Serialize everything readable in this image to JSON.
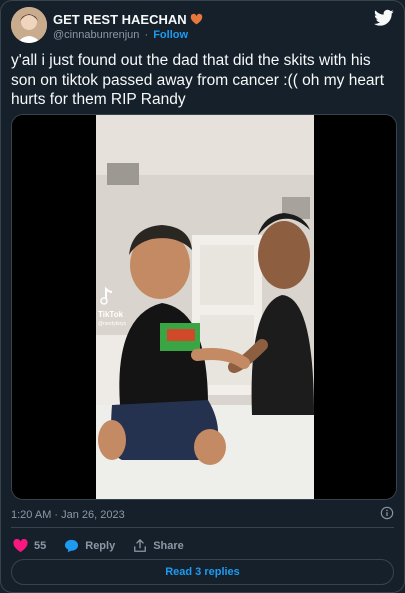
{
  "user": {
    "display_name": "GET REST HAECHAN",
    "handle": "@cinnabunrenjun",
    "separator": "·",
    "follow_label": "Follow",
    "avatar_icon": "avatar-photo",
    "name_emoji": "orange-heart-icon"
  },
  "tweet": {
    "text": "y'all i just found out the dad that did the skits with his son on tiktok passed away from cancer :(( oh my heart hurts for them RIP Randy"
  },
  "media": {
    "watermark_label": "TikTok",
    "watermark_handle": "@randyboys"
  },
  "meta": {
    "timestamp": "1:20 AM · Jan 26, 2023"
  },
  "actions": {
    "likes_count": "55",
    "reply_label": "Reply",
    "share_label": "Share"
  },
  "footer": {
    "read_replies_label": "Read 3 replies"
  },
  "colors": {
    "background": "#15202b",
    "accent": "#1d9bf0",
    "like": "#f91880",
    "muted": "#8b98a5",
    "border": "#38444d"
  }
}
